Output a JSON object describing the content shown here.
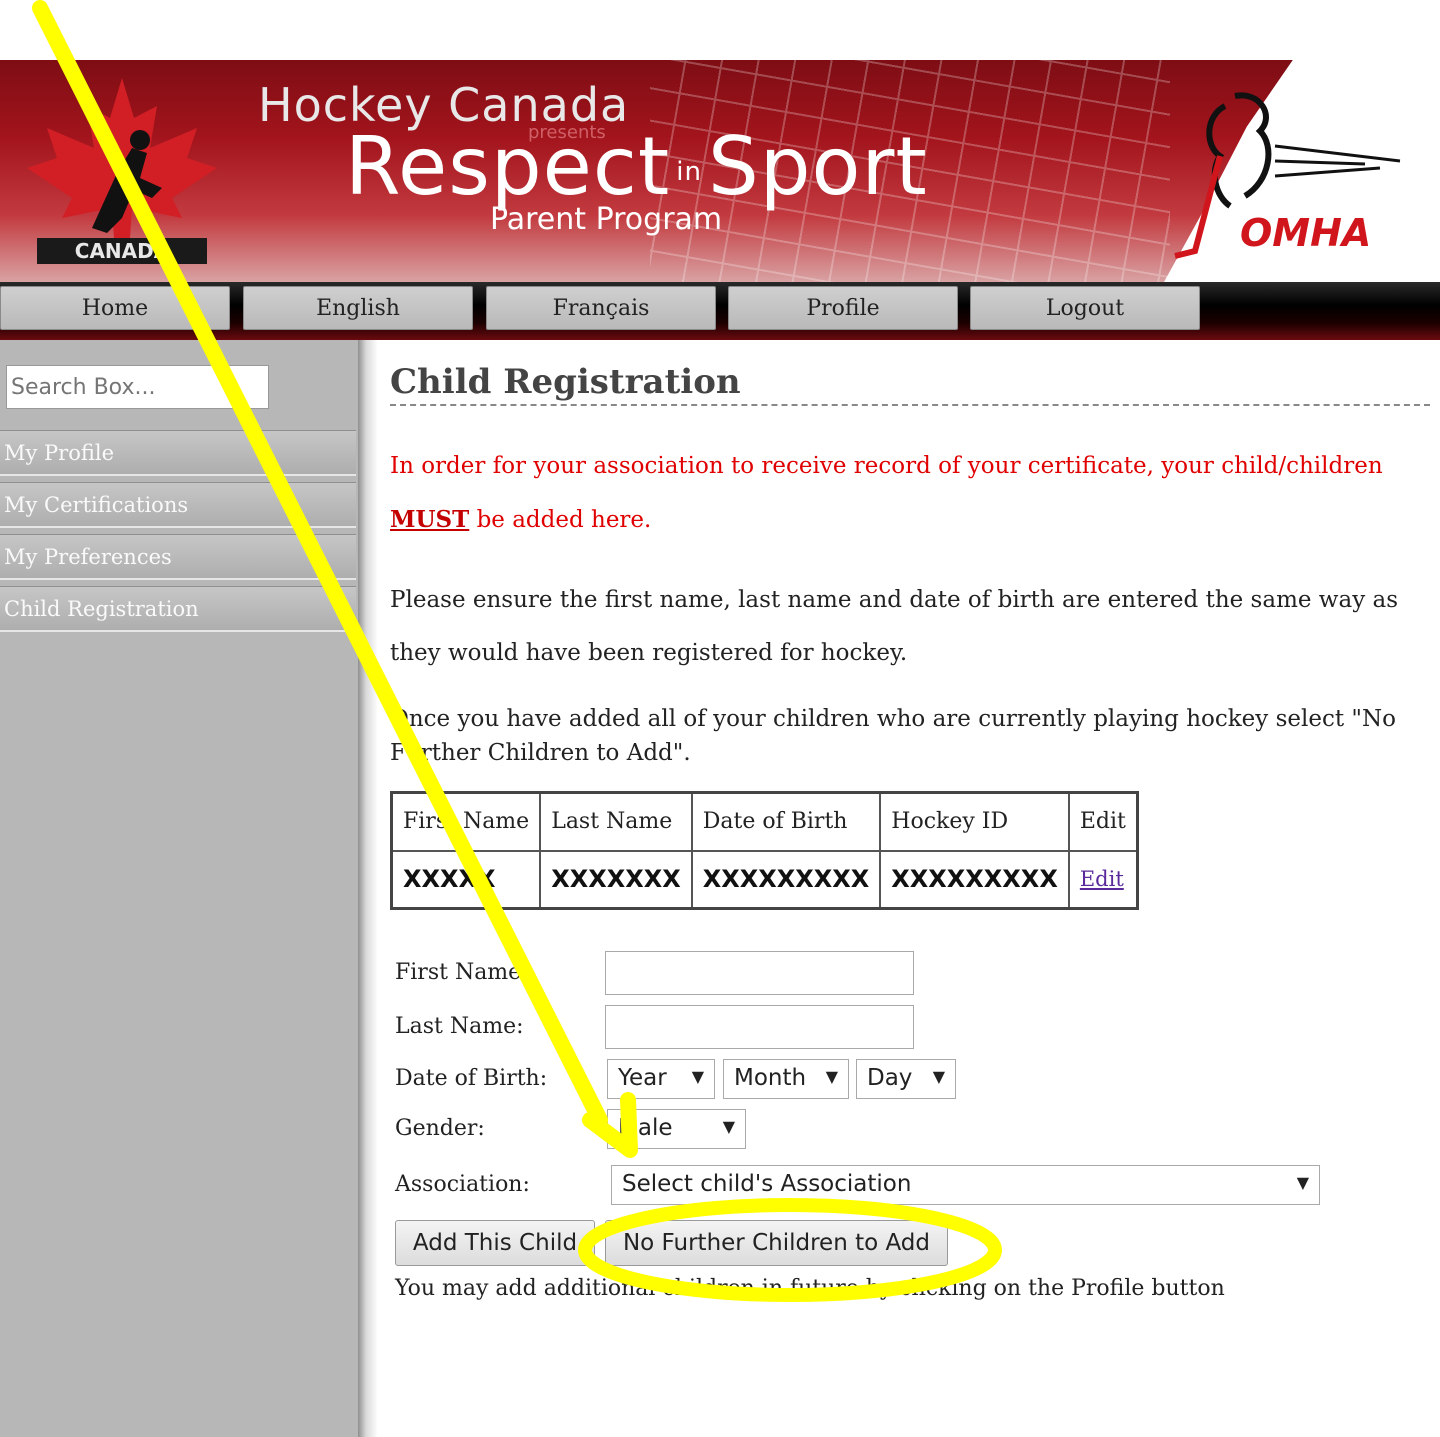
{
  "header": {
    "brand_top": "Hockey Canada",
    "brand_presents": "presents",
    "brand_main_1": "Respect",
    "brand_main_in": "in",
    "brand_main_2": "Sport",
    "brand_sub": "Parent Program",
    "left_logo_text": "CANADA",
    "right_logo_text": "OMHA"
  },
  "nav": {
    "items": [
      {
        "label": "Home"
      },
      {
        "label": "English"
      },
      {
        "label": "Français"
      },
      {
        "label": "Profile"
      },
      {
        "label": "Logout"
      }
    ]
  },
  "sidebar": {
    "search_placeholder": "Search Box...",
    "items": [
      {
        "label": "My Profile"
      },
      {
        "label": "My Certifications"
      },
      {
        "label": "My Preferences"
      },
      {
        "label": "Child Registration"
      }
    ]
  },
  "main": {
    "title": "Child Registration",
    "notice_text": "In order for your association to receive record of your certificate, your child/children",
    "notice_must": "MUST",
    "notice_rest": "be added here.",
    "para1": "Please ensure the first name, last name and date of birth are entered the same way as they would have been registered for hockey.",
    "para2": "Once you have added all of your children who are currently playing hockey select \"No Further Children to Add\".",
    "table": {
      "headers": [
        "First Name",
        "Last Name",
        "Date of Birth",
        "Hockey ID",
        "Edit"
      ],
      "row": [
        "XXXXX",
        "XXXXXXX",
        "XXXXXXXXX",
        "XXXXXXXXX",
        "Edit"
      ]
    },
    "form": {
      "first_name_label": "First Name:",
      "last_name_label": "Last Name:",
      "dob_label": "Date of Birth:",
      "gender_label": "Gender:",
      "association_label": "Association:",
      "year_value": "Year",
      "month_value": "Month",
      "day_value": "Day",
      "gender_value": "Male",
      "association_value": "Select child's Association",
      "add_button": "Add This Child",
      "no_further_button": "No Further Children to Add",
      "footnote": "You may add additional children in future by clicking on the Profile button"
    }
  },
  "colors": {
    "header_red": "#a3141c",
    "notice_red": "#e00000",
    "highlight_yellow": "#ffff00",
    "sidebar_gray": "#b7b7b7"
  }
}
